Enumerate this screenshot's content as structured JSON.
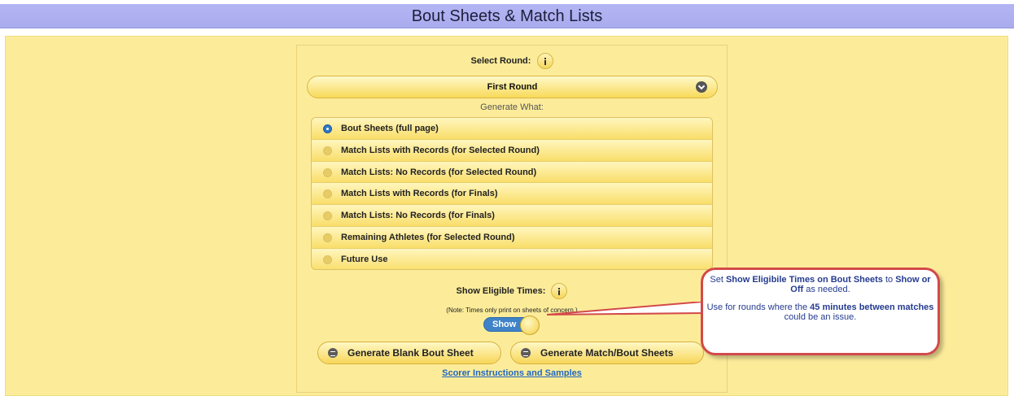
{
  "header": {
    "title": "Bout Sheets & Match Lists"
  },
  "round_select": {
    "label": "Select Round:",
    "value": "First Round"
  },
  "generate": {
    "label": "Generate What:",
    "options": [
      {
        "label": "Bout Sheets (full page)",
        "selected": true
      },
      {
        "label": "Match Lists with Records (for Selected Round)",
        "selected": false
      },
      {
        "label": "Match Lists: No Records (for Selected Round)",
        "selected": false
      },
      {
        "label": "Match Lists with Records (for Finals)",
        "selected": false
      },
      {
        "label": "Match Lists: No Records (for Finals)",
        "selected": false
      },
      {
        "label": "Remaining Athletes (for Selected Round)",
        "selected": false
      },
      {
        "label": "Future Use",
        "selected": false
      }
    ]
  },
  "eligible_times": {
    "label": "Show Eligible Times:",
    "note": "(Note: Times only print on sheets of concern.)",
    "toggle_value": "Show"
  },
  "buttons": {
    "blank": "Generate Blank Bout Sheet",
    "generate": "Generate Match/Bout Sheets"
  },
  "link": "Scorer Instructions and Samples",
  "callout": {
    "p1_pre": "Set ",
    "p1_b1": "Show Eligibile Times on Bout Sheets",
    "p1_mid": " to ",
    "p1_b2": "Show or Off",
    "p1_post": " as needed.",
    "p2_pre": "Use for rounds where the ",
    "p2_b": "45 minutes between matches",
    "p2_post": " could be an issue."
  },
  "colors": {
    "header": "#b3b5f3",
    "background": "#fcec9a",
    "accent": "#3f82c8",
    "callout_border": "#d34a4a"
  }
}
